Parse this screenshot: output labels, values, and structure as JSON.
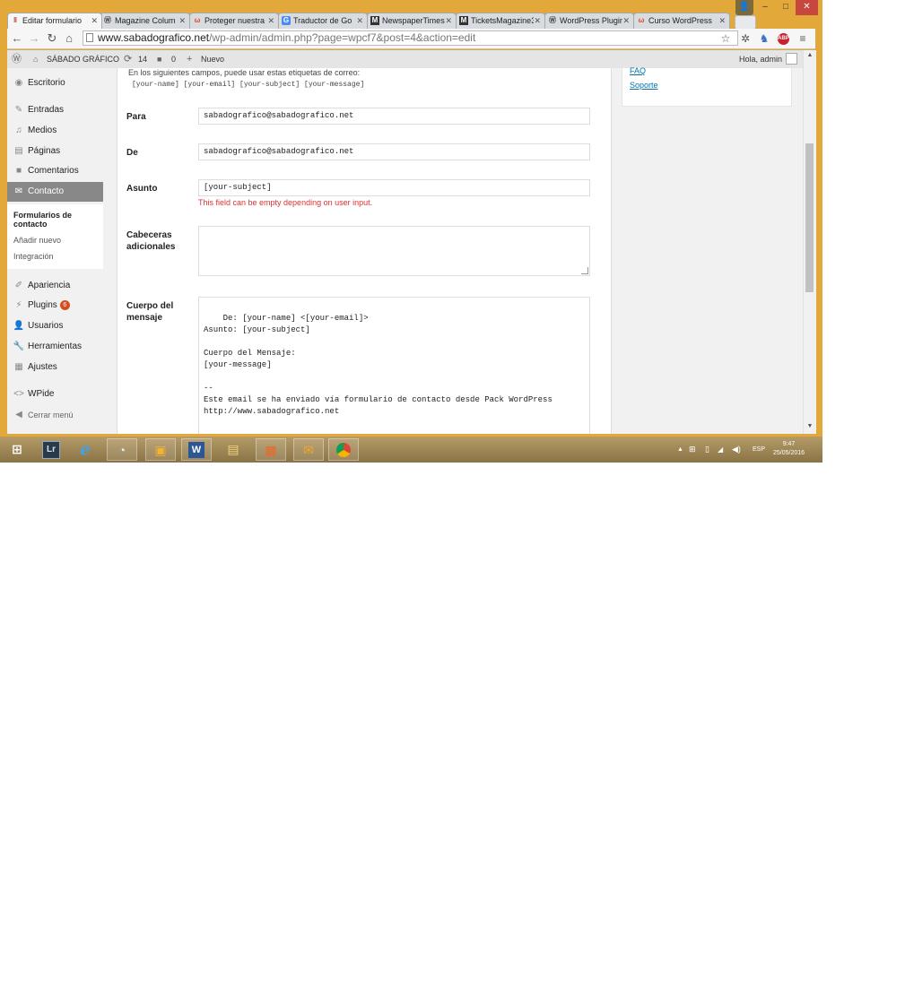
{
  "browser": {
    "tabs": [
      {
        "label": "Editar formulario",
        "favicon": "wpcf7-icon",
        "active": true
      },
      {
        "label": "Magazine Colum",
        "favicon": "wordpress-icon"
      },
      {
        "label": "Proteger nuestra",
        "favicon": "w-icon"
      },
      {
        "label": "Traductor de Go",
        "favicon": "translate-icon"
      },
      {
        "label": "NewspaperTimes",
        "favicon": "m-icon"
      },
      {
        "label": "TicketsMagazine3",
        "favicon": "m-icon"
      },
      {
        "label": "WordPress Plugin",
        "favicon": "wordpress-icon"
      },
      {
        "label": "Curso WordPress",
        "favicon": "w-icon"
      }
    ],
    "tab_close": "✕",
    "url_host": "www.sabadografico.net",
    "url_path": "/wp-admin/admin.php?page=wpcf7&post=4&action=edit",
    "abp_label": "ABP"
  },
  "adminbar": {
    "site_name": "SÁBADO GRÁFICO",
    "updates_count": "14",
    "comments_count": "0",
    "new_label": "Nuevo",
    "greeting": "Hola, admin"
  },
  "menu": {
    "items": [
      {
        "label": "Escritorio",
        "icon": "dashboard-icon"
      },
      {
        "label": "Entradas",
        "icon": "pin-icon"
      },
      {
        "label": "Medios",
        "icon": "media-icon"
      },
      {
        "label": "Páginas",
        "icon": "pages-icon"
      },
      {
        "label": "Comentarios",
        "icon": "comments-icon"
      },
      {
        "label": "Contacto",
        "icon": "mail-icon"
      },
      {
        "label": "Apariencia",
        "icon": "brush-icon"
      },
      {
        "label": "Plugins",
        "icon": "plugin-icon",
        "badge": "6"
      },
      {
        "label": "Usuarios",
        "icon": "users-icon"
      },
      {
        "label": "Herramientas",
        "icon": "tools-icon"
      },
      {
        "label": "Ajustes",
        "icon": "settings-icon"
      },
      {
        "label": "WPide",
        "icon": "code-icon"
      },
      {
        "label": "Cerrar menú",
        "icon": "collapse-icon"
      }
    ],
    "submenu": [
      "Formularios de contacto",
      "Añadir nuevo",
      "Integración"
    ]
  },
  "form": {
    "hint": "En los siguientes campos, puede usar estas etiquetas de correo:",
    "tags": "[your-name] [your-email] [your-subject] [your-message]",
    "para_label": "Para",
    "para_value": "sabadografico@sabadografico.net",
    "de_label": "De",
    "de_value": "sabadografico@sabadografico.net",
    "asunto_label": "Asunto",
    "asunto_value": "[your-subject]",
    "asunto_note": "This field can be empty depending on user input.",
    "cabeceras_label": "Cabeceras adicionales",
    "cabeceras_value": "",
    "cuerpo_label": "Cuerpo del mensaje",
    "cuerpo_value": "De: [your-name] <[your-email]>\nAsunto: [your-subject]\n\nCuerpo del Mensaje:\n[your-message]\n\n--\nEste email se ha enviado vía formulario de contacto desde Pack WordPress\nhttp://www.sabadografico.net"
  },
  "sidebar": {
    "links": [
      "FAQ",
      "Soporte"
    ]
  },
  "taskbar": {
    "apps": [
      "start-icon",
      "lightroom-icon",
      "internet-explorer-icon",
      "app-icon",
      "notes-icon",
      "word-icon",
      "file-explorer-icon",
      "photos-icon",
      "outlook-icon",
      "chrome-icon"
    ],
    "lightroom_label": "Lr",
    "word_label": "W",
    "language": "ESP",
    "time": "9:47",
    "date": "25/05/2016"
  },
  "colors": {
    "window_frame": "#e2a83a",
    "menu_active": "#888888",
    "link": "#0073aa",
    "error": "#dc3232",
    "badge": "#d54e21"
  }
}
